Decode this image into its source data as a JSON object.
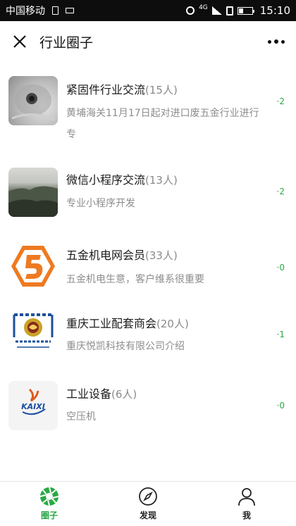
{
  "status_bar": {
    "carrier": "中国移动",
    "network": "4G",
    "time": "15:10"
  },
  "header": {
    "title": "行业圈子"
  },
  "circles": [
    {
      "name": "紧固件行业交流",
      "count": "(15人)",
      "desc": "黄埔海关11月17日起对进口废五金行业进行专",
      "badge": "·2",
      "thumb": "fastener-photo"
    },
    {
      "name": "微信小程序交流",
      "count": "(13人)",
      "desc": "专业小程序开发",
      "badge": "·2",
      "thumb": "landscape-photo"
    },
    {
      "name": "五金机电网会员",
      "count": "(33人)",
      "desc": "五金机电生意，客户维系很重要",
      "badge": "·0",
      "thumb": "number-5-logo"
    },
    {
      "name": "重庆工业配套商会",
      "count": "(20人)",
      "desc": "重庆悦凯科技有限公司介绍",
      "badge": "·1",
      "thumb": "chamber-emblem"
    },
    {
      "name": "工业设备",
      "count": "(6人)",
      "desc": "空压机",
      "badge": "·0",
      "thumb": "kaixi-logo",
      "logo_text": "KAIXI"
    }
  ],
  "tabs": [
    {
      "label": "圈子",
      "icon": "aperture-icon",
      "active": true
    },
    {
      "label": "发现",
      "icon": "compass-icon",
      "active": false
    },
    {
      "label": "我",
      "icon": "person-icon",
      "active": false
    }
  ],
  "colors": {
    "accent": "#2aa845",
    "status_bar": "#0d0d0d",
    "muted_text": "#8d8d8d"
  }
}
